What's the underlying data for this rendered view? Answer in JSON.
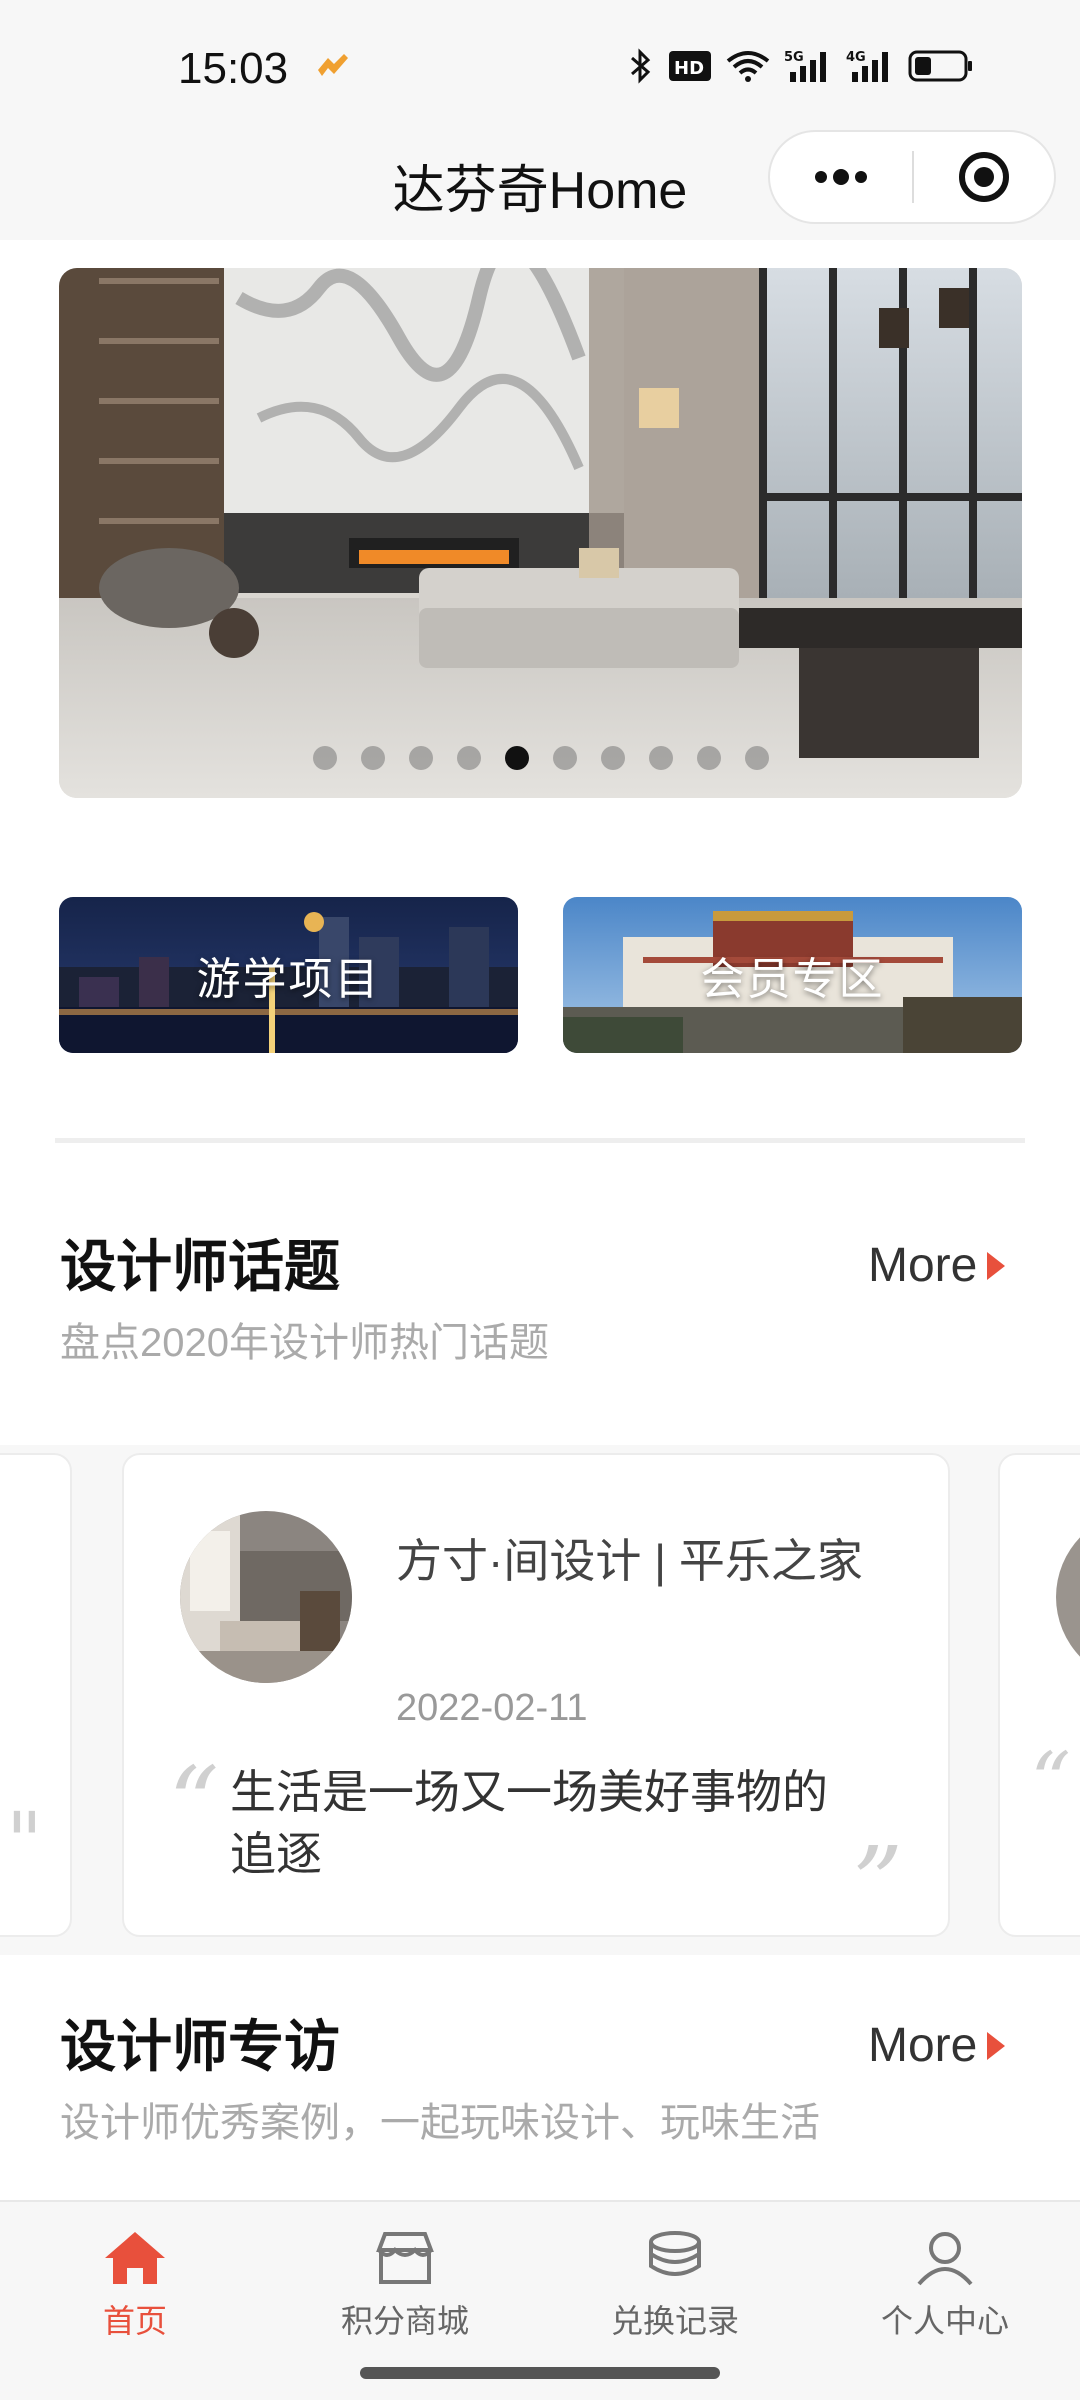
{
  "status": {
    "time": "15:03"
  },
  "header": {
    "title": "达芬奇Home"
  },
  "banner": {
    "dot_count": 10,
    "active_dot": 4
  },
  "tiles": [
    {
      "label": "游学项目"
    },
    {
      "label": "会员专区"
    }
  ],
  "topics": {
    "title": "设计师话题",
    "subtitle": "盘点2020年设计师热门话题",
    "more": "More",
    "card": {
      "title": "方寸·间设计 | 平乐之家",
      "date": "2022-02-11",
      "quote": "生活是一场又一场美好事物的追逐"
    }
  },
  "interviews": {
    "title": "设计师专访",
    "subtitle": "设计师优秀案例，一起玩味设计、玩味生活",
    "more": "More"
  },
  "tabbar": [
    {
      "label": "首页",
      "icon": "home-icon",
      "active": true
    },
    {
      "label": "积分商城",
      "icon": "store-icon",
      "active": false
    },
    {
      "label": "兑换记录",
      "icon": "coins-icon",
      "active": false
    },
    {
      "label": "个人中心",
      "icon": "person-icon",
      "active": false
    }
  ],
  "colors": {
    "accent": "#e8503c",
    "background": "#f7f7f7"
  }
}
